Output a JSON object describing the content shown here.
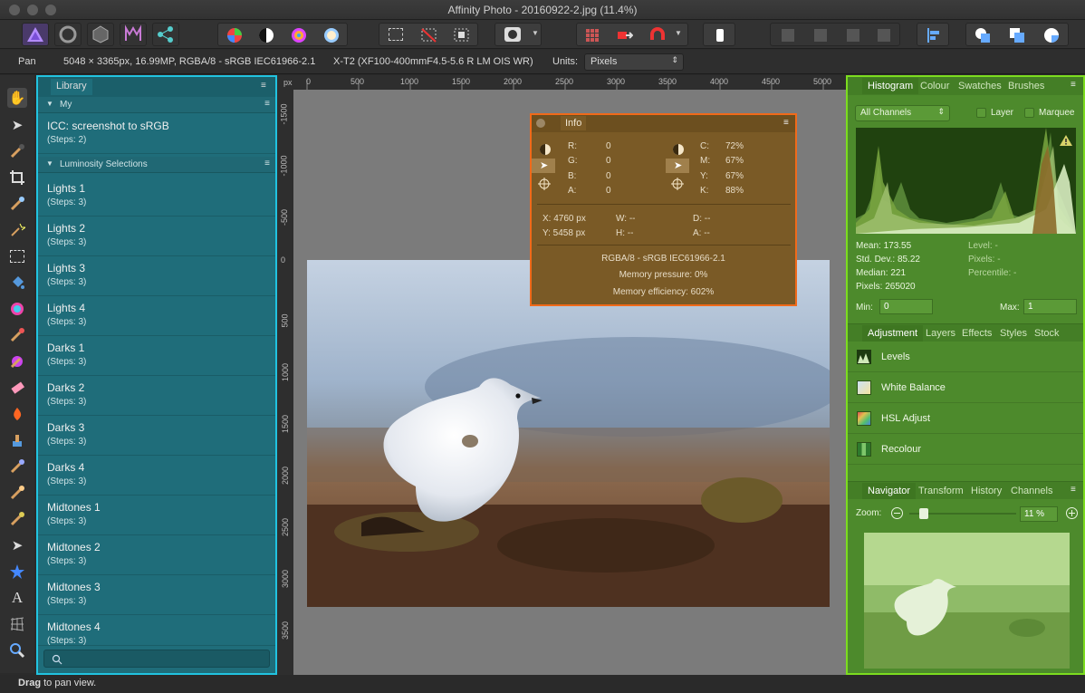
{
  "window": {
    "title": "Affinity Photo - 20160922-2.jpg (11.4%)"
  },
  "context_bar": {
    "tool": "Pan",
    "doc_info": "5048 × 3365px, 16.99MP, RGBA/8 - sRGB IEC61966-2.1",
    "camera": "X-T2 (XF100-400mmF4.5-5.6 R LM OIS WR)",
    "units_label": "Units:",
    "units_value": "Pixels"
  },
  "rulers": {
    "h": [
      "0",
      "500",
      "1000",
      "1500",
      "2000",
      "2500",
      "3000",
      "3500",
      "4000",
      "4500",
      "5000"
    ],
    "unit": "px",
    "v": [
      "-1500",
      "-1000",
      "-500",
      "0",
      "500",
      "1000",
      "1500",
      "2000",
      "2500",
      "3000",
      "3500"
    ]
  },
  "library": {
    "tab": "Library",
    "sections": [
      {
        "label": "My"
      },
      {
        "label": "Luminosity Selections"
      }
    ],
    "items": [
      {
        "title": "ICC: screenshot to sRGB",
        "steps": "(Steps: 2)"
      },
      {
        "title": "Lights 1",
        "steps": "(Steps: 3)"
      },
      {
        "title": "Lights 2",
        "steps": "(Steps: 3)"
      },
      {
        "title": "Lights 3",
        "steps": "(Steps: 3)"
      },
      {
        "title": "Lights 4",
        "steps": "(Steps: 3)"
      },
      {
        "title": "Darks 1",
        "steps": "(Steps: 3)"
      },
      {
        "title": "Darks 2",
        "steps": "(Steps: 3)"
      },
      {
        "title": "Darks 3",
        "steps": "(Steps: 3)"
      },
      {
        "title": "Darks 4",
        "steps": "(Steps: 3)"
      },
      {
        "title": "Midtones 1",
        "steps": "(Steps: 3)"
      },
      {
        "title": "Midtones 2",
        "steps": "(Steps: 3)"
      },
      {
        "title": "Midtones 3",
        "steps": "(Steps: 3)"
      },
      {
        "title": "Midtones 4",
        "steps": "(Steps: 3)"
      }
    ]
  },
  "info_panel": {
    "tab": "Info",
    "rgb": {
      "r_label": "R:",
      "r": "0",
      "g_label": "G:",
      "g": "0",
      "b_label": "B:",
      "b": "0",
      "a_label": "A:",
      "a": "0"
    },
    "cmyk": {
      "c_label": "C:",
      "c": "72%",
      "m_label": "M:",
      "m": "67%",
      "y_label": "Y:",
      "y": "67%",
      "k_label": "K:",
      "k": "88%"
    },
    "pos": {
      "x": "X: 4760 px",
      "y": "Y: 5458 px",
      "w": "W: --",
      "h": "H: --",
      "d": "D: --",
      "a": "A: --"
    },
    "color_format": "RGBA/8 - sRGB IEC61966-2.1",
    "memory_pressure": "Memory pressure: 0%",
    "memory_efficiency": "Memory efficiency: 602%"
  },
  "histogram_panel": {
    "tabs": [
      "Histogram",
      "Colour",
      "Swatches",
      "Brushes"
    ],
    "channel": "All Channels",
    "layer_label": "Layer",
    "marquee_label": "Marquee",
    "stats": {
      "mean": "Mean: 173.55",
      "std": "Std. Dev.: 85.22",
      "median": "Median: 221",
      "pixels": "Pixels: 265020",
      "level": "Level: -",
      "rpixels": "Pixels: -",
      "percentile": "Percentile: -"
    },
    "min_label": "Min:",
    "min_value": "0",
    "max_label": "Max:",
    "max_value": "1"
  },
  "adjustment_panel": {
    "tabs": [
      "Adjustment",
      "Layers",
      "Effects",
      "Styles",
      "Stock"
    ],
    "items": [
      "Levels",
      "White Balance",
      "HSL Adjust",
      "Recolour"
    ]
  },
  "navigator_panel": {
    "tabs": [
      "Navigator",
      "Transform",
      "History",
      "Channels"
    ],
    "zoom_label": "Zoom:",
    "zoom_value": "11 %",
    "zoom_level": 0.11
  },
  "status": {
    "bold": "Drag",
    "text": "to pan view."
  },
  "colors": {
    "library_accent": "#21c3e0",
    "info_accent": "#f06a1a",
    "right_accent": "#7cdc1f"
  }
}
